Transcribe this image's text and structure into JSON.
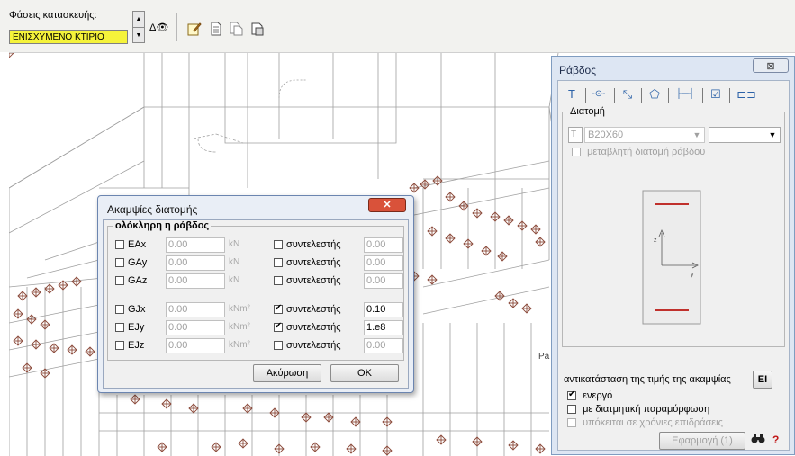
{
  "toolbar": {
    "phase_label": "Φάσεις κατασκευής:",
    "phase_value": "ΕΝΙΣΧΥΜΕΝΟ ΚΤΙΡΙΟ",
    "eye_label": "Δ👁",
    "icons": [
      "edit-icon",
      "document-icon",
      "copy-document-icon",
      "print-icon"
    ]
  },
  "rod_window": {
    "title": "Ράβδος",
    "close_glyph": "⊠",
    "tabs": [
      "T",
      "-⊙-",
      "⤡",
      "⬠",
      "├─┤",
      "☑",
      "⊏⊐"
    ],
    "section_group_title": "Διατομή",
    "section_value": "B20X60",
    "variable_section_label": "μεταβλητή διατομή ράβδου",
    "replace_label": "αντικατάσταση της τιμής της ακαμψίας",
    "ei_button": "EI",
    "active_label": "ενεργό",
    "shear_label": "με διατμητική παραμόρφωση",
    "time_label": "υπόκειται σε χρόνιες επιδράσεις",
    "apply_button": "Εφαρμογή (1)",
    "help_glyph": "?",
    "partial_label": "Pa",
    "axis_z": "z",
    "axis_y": "y"
  },
  "stiffness_dialog": {
    "title": "Ακαμψίες διατομής",
    "close_glyph": "✕",
    "group_title": "ολόκληρη η ράβδος",
    "coef_label": "συντελεστής",
    "rows": [
      {
        "label": "EAx",
        "value": "0.00",
        "unit": "kN",
        "coef_checked": false,
        "coef_value": "0.00"
      },
      {
        "label": "GAy",
        "value": "0.00",
        "unit": "kN",
        "coef_checked": false,
        "coef_value": "0.00"
      },
      {
        "label": "GAz",
        "value": "0.00",
        "unit": "kN",
        "coef_checked": false,
        "coef_value": "0.00"
      },
      {
        "label": "GJx",
        "value": "0.00",
        "unit": "kNm²",
        "coef_checked": true,
        "coef_value": "0.10"
      },
      {
        "label": "EJy",
        "value": "0.00",
        "unit": "kNm²",
        "coef_checked": true,
        "coef_value": "1.e8"
      },
      {
        "label": "EJz",
        "value": "0.00",
        "unit": "kNm²",
        "coef_checked": false,
        "coef_value": "0.00"
      }
    ],
    "cancel_button": "Ακύρωση",
    "ok_button": "OK"
  },
  "colors": {
    "phase_bg": "#f5f33a",
    "wire": "#9a9a9a",
    "support": "#8b4a3a",
    "section_line": "#c0302c"
  }
}
